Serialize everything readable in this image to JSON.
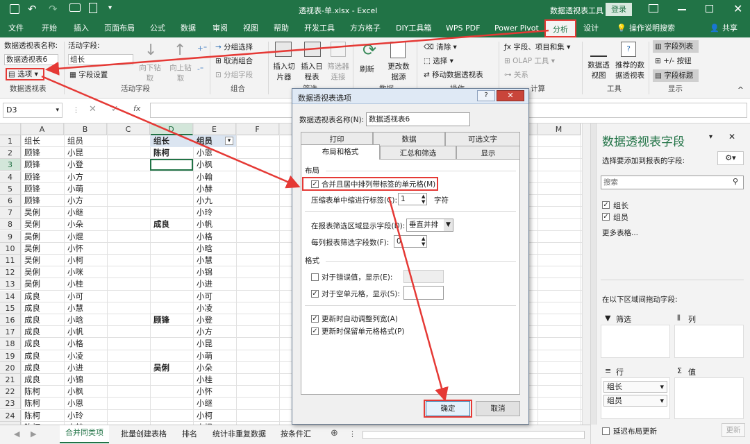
{
  "window": {
    "title": "透视表-单.xlsx - Excel",
    "context_label": "数据透视表工具",
    "login_label": "登录"
  },
  "tabs": [
    "文件",
    "开始",
    "插入",
    "页面布局",
    "公式",
    "数据",
    "审阅",
    "视图",
    "帮助",
    "开发工具",
    "方方格子",
    "DIY工具箱",
    "WPS PDF",
    "Power Pivot",
    "分析",
    "设计"
  ],
  "tell_me": "操作说明搜索",
  "share": "共享",
  "ribbon": {
    "pt_name_label": "数据透视表名称:",
    "pt_name_value": "数据透视表6",
    "options_label": "选项",
    "group1": "数据透视表",
    "active_field_label": "活动字段:",
    "active_field_value": "组长",
    "field_settings": "字段设置",
    "drill_down": "向下钻取",
    "drill_up": "向上钻取",
    "group2": "活动字段",
    "group_selection": "分组选择",
    "ungroup": "取消组合",
    "group_field": "分组字段",
    "group3": "组合",
    "insert_slicer": "插入切片器",
    "insert_timeline": "插入日程表",
    "filter_conn": "筛选器连接",
    "group4": "筛选",
    "refresh": "刷新",
    "change_source": "更改数据源",
    "group5": "数据",
    "clear": "清除",
    "select": "选择",
    "move_pt": "移动数据透视表",
    "group6": "操作",
    "fields_items": "字段、项目和集",
    "olap": "OLAP 工具",
    "relations": "关系",
    "group7": "计算",
    "pivotchart": "数据透视图",
    "recommended": "推荐的数据透视表",
    "group8": "工具",
    "field_list": "字段列表",
    "buttons": "+/- 按钮",
    "field_headers": "字段标题",
    "group9": "显示"
  },
  "formula_bar": {
    "namebox": "D3",
    "fx": "fx",
    "formula": ""
  },
  "columns": [
    "A",
    "B",
    "C",
    "D",
    "E",
    "F",
    "G",
    "H",
    "I",
    "J",
    "K",
    "L",
    "M"
  ],
  "rows": [
    "1",
    "2",
    "3",
    "4",
    "5",
    "6",
    "7",
    "8",
    "9",
    "10",
    "11",
    "12",
    "13",
    "14",
    "15",
    "16",
    "17",
    "18",
    "19",
    "20",
    "21",
    "22",
    "23",
    "24",
    "25"
  ],
  "col_a": [
    "组长",
    "顾锋",
    "顾锋",
    "顾锋",
    "顾锋",
    "顾锋",
    "吴俐",
    "吴俐",
    "吴俐",
    "吴俐",
    "吴俐",
    "吴俐",
    "吴俐",
    "成良",
    "成良",
    "成良",
    "成良",
    "成良",
    "成良",
    "成良",
    "成良",
    "陈柯",
    "陈柯",
    "陈柯",
    "陈柯"
  ],
  "col_b": [
    "组员",
    "小昆",
    "小登",
    "小方",
    "小萌",
    "小方",
    "小继",
    "小朵",
    "小焜",
    "小怀",
    "小柯",
    "小咪",
    "小桂",
    "小可",
    "小慧",
    "小晗",
    "小帆",
    "小格",
    "小凌",
    "小进",
    "小锦",
    "小枫",
    "小恩",
    "小玲",
    "小赫"
  ],
  "pivot_header": [
    "组长",
    "组员"
  ],
  "pivot_groups": [
    {
      "row": 2,
      "label": "陈柯"
    },
    {
      "row": 8,
      "label": "成良"
    },
    {
      "row": 16,
      "label": "顾锋"
    },
    {
      "row": 20,
      "label": "吴俐"
    }
  ],
  "col_e": [
    "小恩",
    "小枫",
    "小翰",
    "小赫",
    "小九",
    "小玲",
    "小帆",
    "小格",
    "小晗",
    "小慧",
    "小锦",
    "小进",
    "小可",
    "小凌",
    "小登",
    "小方",
    "小昆",
    "小萌",
    "小朵",
    "小桂",
    "小怀",
    "小继",
    "小柯",
    "小焜"
  ],
  "sheet_tabs": [
    "合并同类项",
    "批量创建表格",
    "排名",
    "统计非重复数据",
    "按条件汇"
  ],
  "pane": {
    "title": "数据透视表字段",
    "subtitle": "选择要添加到报表的字段:",
    "search_placeholder": "搜索",
    "fields": [
      "组长",
      "组员"
    ],
    "more_tables": "更多表格...",
    "drag_label": "在以下区域间拖动字段:",
    "filter_label": "筛选",
    "columns_label": "列",
    "rows_label": "行",
    "values_label": "值",
    "row_fields": [
      "组长",
      "组员"
    ],
    "defer_label": "延迟布局更新",
    "update_label": "更新"
  },
  "dialog": {
    "title": "数据透视表选项",
    "name_label": "数据透视表名称(N):",
    "name_value": "数据透视表6",
    "tabs_row1": [
      "打印",
      "数据",
      "可选文字"
    ],
    "tabs_row2": [
      "布局和格式",
      "汇总和筛选",
      "显示"
    ],
    "section_layout": "布局",
    "merge_label": "合并且居中排列带标签的单元格(M)",
    "indent_label": "压缩表单中缩进行标签(C):",
    "indent_value": "1",
    "indent_unit": "字符",
    "filter_area_label": "在报表筛选区域显示字段(D):",
    "filter_area_value": "垂直并排",
    "per_column_label": "每列报表筛选字段数(F):",
    "per_column_value": "0",
    "section_format": "格式",
    "error_label": "对于错误值，显示(E):",
    "empty_label": "对于空单元格，显示(S):",
    "autofit_label": "更新时自动调整列宽(A)",
    "preserve_label": "更新时保留单元格格式(P)",
    "ok": "确定",
    "cancel": "取消"
  },
  "colors": {
    "excel_green": "#217346",
    "arrow_red": "#e53935"
  }
}
